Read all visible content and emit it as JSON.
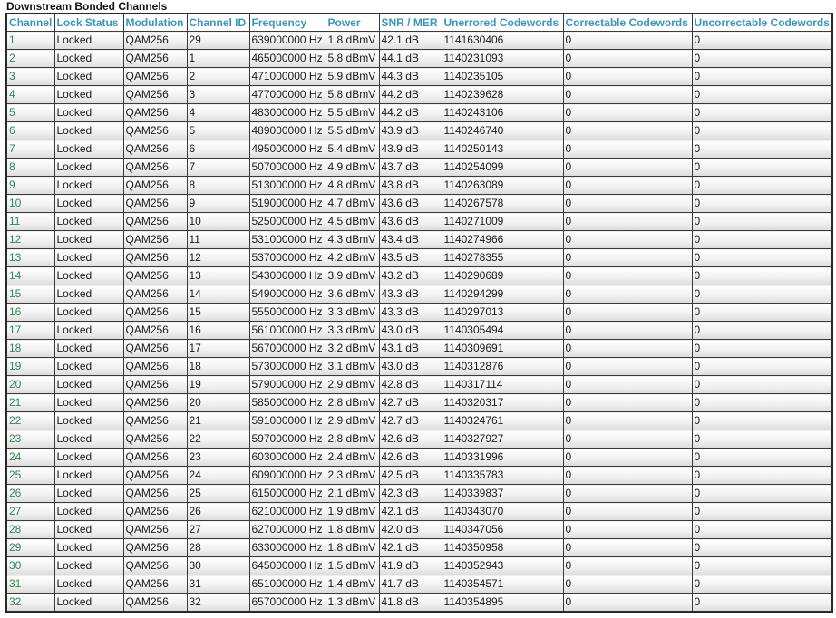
{
  "section_title": "Downstream Bonded Channels",
  "columns": [
    "Channel",
    "Lock Status",
    "Modulation",
    "Channel ID",
    "Frequency",
    "Power",
    "SNR / MER",
    "Unerrored Codewords",
    "Correctable Codewords",
    "Uncorrectable Codewords"
  ],
  "rows": [
    [
      "1",
      "Locked",
      "QAM256",
      "29",
      "639000000 Hz",
      "1.8 dBmV",
      "42.1 dB",
      "1141630406",
      "0",
      "0"
    ],
    [
      "2",
      "Locked",
      "QAM256",
      "1",
      "465000000 Hz",
      "5.8 dBmV",
      "44.1 dB",
      "1140231093",
      "0",
      "0"
    ],
    [
      "3",
      "Locked",
      "QAM256",
      "2",
      "471000000 Hz",
      "5.9 dBmV",
      "44.3 dB",
      "1140235105",
      "0",
      "0"
    ],
    [
      "4",
      "Locked",
      "QAM256",
      "3",
      "477000000 Hz",
      "5.8 dBmV",
      "44.2 dB",
      "1140239628",
      "0",
      "0"
    ],
    [
      "5",
      "Locked",
      "QAM256",
      "4",
      "483000000 Hz",
      "5.5 dBmV",
      "44.2 dB",
      "1140243106",
      "0",
      "0"
    ],
    [
      "6",
      "Locked",
      "QAM256",
      "5",
      "489000000 Hz",
      "5.5 dBmV",
      "43.9 dB",
      "1140246740",
      "0",
      "0"
    ],
    [
      "7",
      "Locked",
      "QAM256",
      "6",
      "495000000 Hz",
      "5.4 dBmV",
      "43.9 dB",
      "1140250143",
      "0",
      "0"
    ],
    [
      "8",
      "Locked",
      "QAM256",
      "7",
      "507000000 Hz",
      "4.9 dBmV",
      "43.7 dB",
      "1140254099",
      "0",
      "0"
    ],
    [
      "9",
      "Locked",
      "QAM256",
      "8",
      "513000000 Hz",
      "4.8 dBmV",
      "43.8 dB",
      "1140263089",
      "0",
      "0"
    ],
    [
      "10",
      "Locked",
      "QAM256",
      "9",
      "519000000 Hz",
      "4.7 dBmV",
      "43.6 dB",
      "1140267578",
      "0",
      "0"
    ],
    [
      "11",
      "Locked",
      "QAM256",
      "10",
      "525000000 Hz",
      "4.5 dBmV",
      "43.6 dB",
      "1140271009",
      "0",
      "0"
    ],
    [
      "12",
      "Locked",
      "QAM256",
      "11",
      "531000000 Hz",
      "4.3 dBmV",
      "43.4 dB",
      "1140274966",
      "0",
      "0"
    ],
    [
      "13",
      "Locked",
      "QAM256",
      "12",
      "537000000 Hz",
      "4.2 dBmV",
      "43.5 dB",
      "1140278355",
      "0",
      "0"
    ],
    [
      "14",
      "Locked",
      "QAM256",
      "13",
      "543000000 Hz",
      "3.9 dBmV",
      "43.2 dB",
      "1140290689",
      "0",
      "0"
    ],
    [
      "15",
      "Locked",
      "QAM256",
      "14",
      "549000000 Hz",
      "3.6 dBmV",
      "43.3 dB",
      "1140294299",
      "0",
      "0"
    ],
    [
      "16",
      "Locked",
      "QAM256",
      "15",
      "555000000 Hz",
      "3.3 dBmV",
      "43.3 dB",
      "1140297013",
      "0",
      "0"
    ],
    [
      "17",
      "Locked",
      "QAM256",
      "16",
      "561000000 Hz",
      "3.3 dBmV",
      "43.0 dB",
      "1140305494",
      "0",
      "0"
    ],
    [
      "18",
      "Locked",
      "QAM256",
      "17",
      "567000000 Hz",
      "3.2 dBmV",
      "43.1 dB",
      "1140309691",
      "0",
      "0"
    ],
    [
      "19",
      "Locked",
      "QAM256",
      "18",
      "573000000 Hz",
      "3.1 dBmV",
      "43.0 dB",
      "1140312876",
      "0",
      "0"
    ],
    [
      "20",
      "Locked",
      "QAM256",
      "19",
      "579000000 Hz",
      "2.9 dBmV",
      "42.8 dB",
      "1140317114",
      "0",
      "0"
    ],
    [
      "21",
      "Locked",
      "QAM256",
      "20",
      "585000000 Hz",
      "2.8 dBmV",
      "42.7 dB",
      "1140320317",
      "0",
      "0"
    ],
    [
      "22",
      "Locked",
      "QAM256",
      "21",
      "591000000 Hz",
      "2.9 dBmV",
      "42.7 dB",
      "1140324761",
      "0",
      "0"
    ],
    [
      "23",
      "Locked",
      "QAM256",
      "22",
      "597000000 Hz",
      "2.8 dBmV",
      "42.6 dB",
      "1140327927",
      "0",
      "0"
    ],
    [
      "24",
      "Locked",
      "QAM256",
      "23",
      "603000000 Hz",
      "2.4 dBmV",
      "42.6 dB",
      "1140331996",
      "0",
      "0"
    ],
    [
      "25",
      "Locked",
      "QAM256",
      "24",
      "609000000 Hz",
      "2.3 dBmV",
      "42.5 dB",
      "1140335783",
      "0",
      "0"
    ],
    [
      "26",
      "Locked",
      "QAM256",
      "25",
      "615000000 Hz",
      "2.1 dBmV",
      "42.3 dB",
      "1140339837",
      "0",
      "0"
    ],
    [
      "27",
      "Locked",
      "QAM256",
      "26",
      "621000000 Hz",
      "1.9 dBmV",
      "42.1 dB",
      "1140343070",
      "0",
      "0"
    ],
    [
      "28",
      "Locked",
      "QAM256",
      "27",
      "627000000 Hz",
      "1.8 dBmV",
      "42.0 dB",
      "1140347056",
      "0",
      "0"
    ],
    [
      "29",
      "Locked",
      "QAM256",
      "28",
      "633000000 Hz",
      "1.8 dBmV",
      "42.1 dB",
      "1140350958",
      "0",
      "0"
    ],
    [
      "30",
      "Locked",
      "QAM256",
      "30",
      "645000000 Hz",
      "1.5 dBmV",
      "41.9 dB",
      "1140352943",
      "0",
      "0"
    ],
    [
      "31",
      "Locked",
      "QAM256",
      "31",
      "651000000 Hz",
      "1.4 dBmV",
      "41.7 dB",
      "1140354571",
      "0",
      "0"
    ],
    [
      "32",
      "Locked",
      "QAM256",
      "32",
      "657000000 Hz",
      "1.3 dBmV",
      "41.8 dB",
      "1140354895",
      "0",
      "0"
    ]
  ],
  "colors": {
    "header_text": "#3b96bd",
    "channel_text": "#2d8a55",
    "border": "#3a3a3a"
  }
}
